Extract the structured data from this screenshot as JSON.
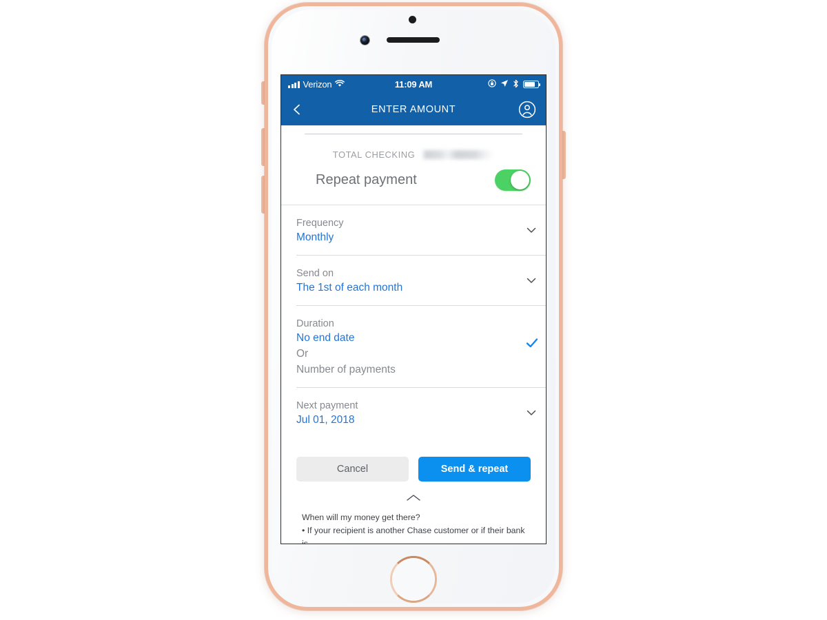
{
  "status_bar": {
    "carrier": "Verizon",
    "time": "11:09 AM",
    "icons": [
      "signal-bars-icon",
      "wifi-icon",
      "alarm-lock-icon",
      "location-arrow-icon",
      "bluetooth-icon",
      "battery-icon"
    ]
  },
  "nav_bar": {
    "back_icon": "chevron-left-icon",
    "title": "ENTER AMOUNT",
    "avatar_icon": "user-circle-icon"
  },
  "account": {
    "label": "TOTAL CHECKING",
    "number_redacted": true
  },
  "repeat": {
    "label": "Repeat payment",
    "toggle_on": true,
    "toggle_color": "#4CD264"
  },
  "fields": [
    {
      "label": "Frequency",
      "value": "Monthly",
      "accessory": "chevron-down-icon"
    },
    {
      "label": "Send on",
      "value": "The 1st of each month",
      "accessory": "chevron-down-icon"
    },
    {
      "label": "Duration",
      "value": "No end date",
      "or_label": "Or",
      "alt_option": "Number of payments",
      "accessory": "check-icon"
    },
    {
      "label": "Next payment",
      "value": "Jul 01, 2018",
      "accessory": "chevron-down-icon"
    }
  ],
  "actions": {
    "cancel_label": "Cancel",
    "primary_label": "Send & repeat",
    "primary_color": "#0B90F0"
  },
  "collapse": {
    "icon": "chevron-up-icon"
  },
  "footer": {
    "heading": "When will my money get there?",
    "bullet": "• If your recipient is another Chase customer or if their bank is"
  },
  "theme": {
    "header_blue": "#1160A8",
    "link_blue": "#2175D9",
    "device_color": "#F0B69B"
  }
}
